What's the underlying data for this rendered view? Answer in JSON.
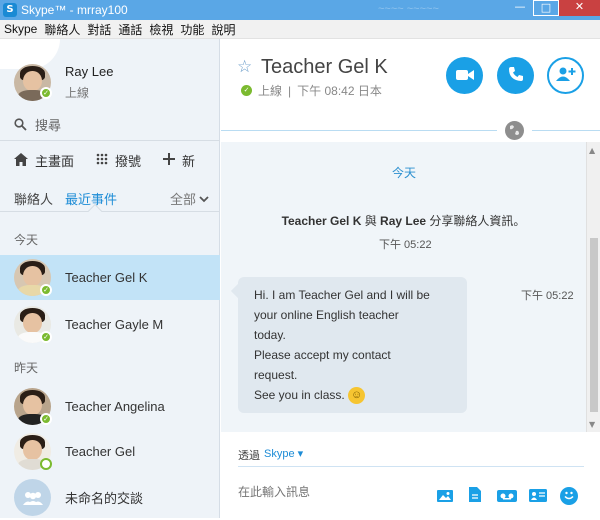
{
  "window": {
    "title": "Skype™ - mrray100",
    "blurred_text": "~~~~ ~~~~~",
    "minimize": "—",
    "maximize": "□",
    "close": "✕"
  },
  "menu": [
    "Skype",
    "聯絡人",
    "對話",
    "通話",
    "檢視",
    "功能",
    "說明"
  ],
  "profile": {
    "name": "Ray Lee",
    "status": "上線"
  },
  "search": {
    "placeholder": "搜尋"
  },
  "nav": {
    "home": "主畫面",
    "dialpad": "撥號",
    "new": "新"
  },
  "tabs": {
    "contacts": "聯絡人",
    "recent": "最近事件",
    "all": "全部"
  },
  "sections": {
    "today": "今天",
    "yesterday": "昨天"
  },
  "contacts": [
    {
      "name": "Teacher Gel K"
    },
    {
      "name": "Teacher Gayle  M"
    },
    {
      "name": "Teacher Angelina"
    },
    {
      "name": "Teacher Gel"
    },
    {
      "name": "未命名的交談"
    }
  ],
  "chat": {
    "title": "Teacher Gel K",
    "status": "上線",
    "separator": "|",
    "local_time": "下午 08:42 日本",
    "day_label": "今天",
    "system_message": {
      "user1": "Teacher Gel K",
      "connector": " 與 ",
      "user2": "Ray Lee",
      "text": " 分享聯絡人資訊。"
    },
    "system_time": "下午 05:22",
    "message_lines": [
      "Hi. I am Teacher Gel and I will be",
      "your online English teacher",
      "today.",
      "Please accept my contact",
      "request.",
      "See you in class."
    ],
    "message_time": "下午 05:22",
    "via_label": "透過",
    "via_value": "Skype ▾",
    "input_placeholder": "在此輸入訊息"
  },
  "colors": {
    "accent": "#1aa0e6",
    "online": "#7bba2f",
    "selected": "#c2e3f7"
  },
  "icons": [
    "star-icon",
    "video-call-icon",
    "phone-call-icon",
    "add-contact-icon",
    "globe-icon",
    "search-icon",
    "home-icon",
    "dialpad-icon",
    "plus-icon",
    "chevron-down-icon",
    "send-image-icon",
    "send-file-icon",
    "video-message-icon",
    "contacts-card-icon",
    "emoticon-icon"
  ]
}
